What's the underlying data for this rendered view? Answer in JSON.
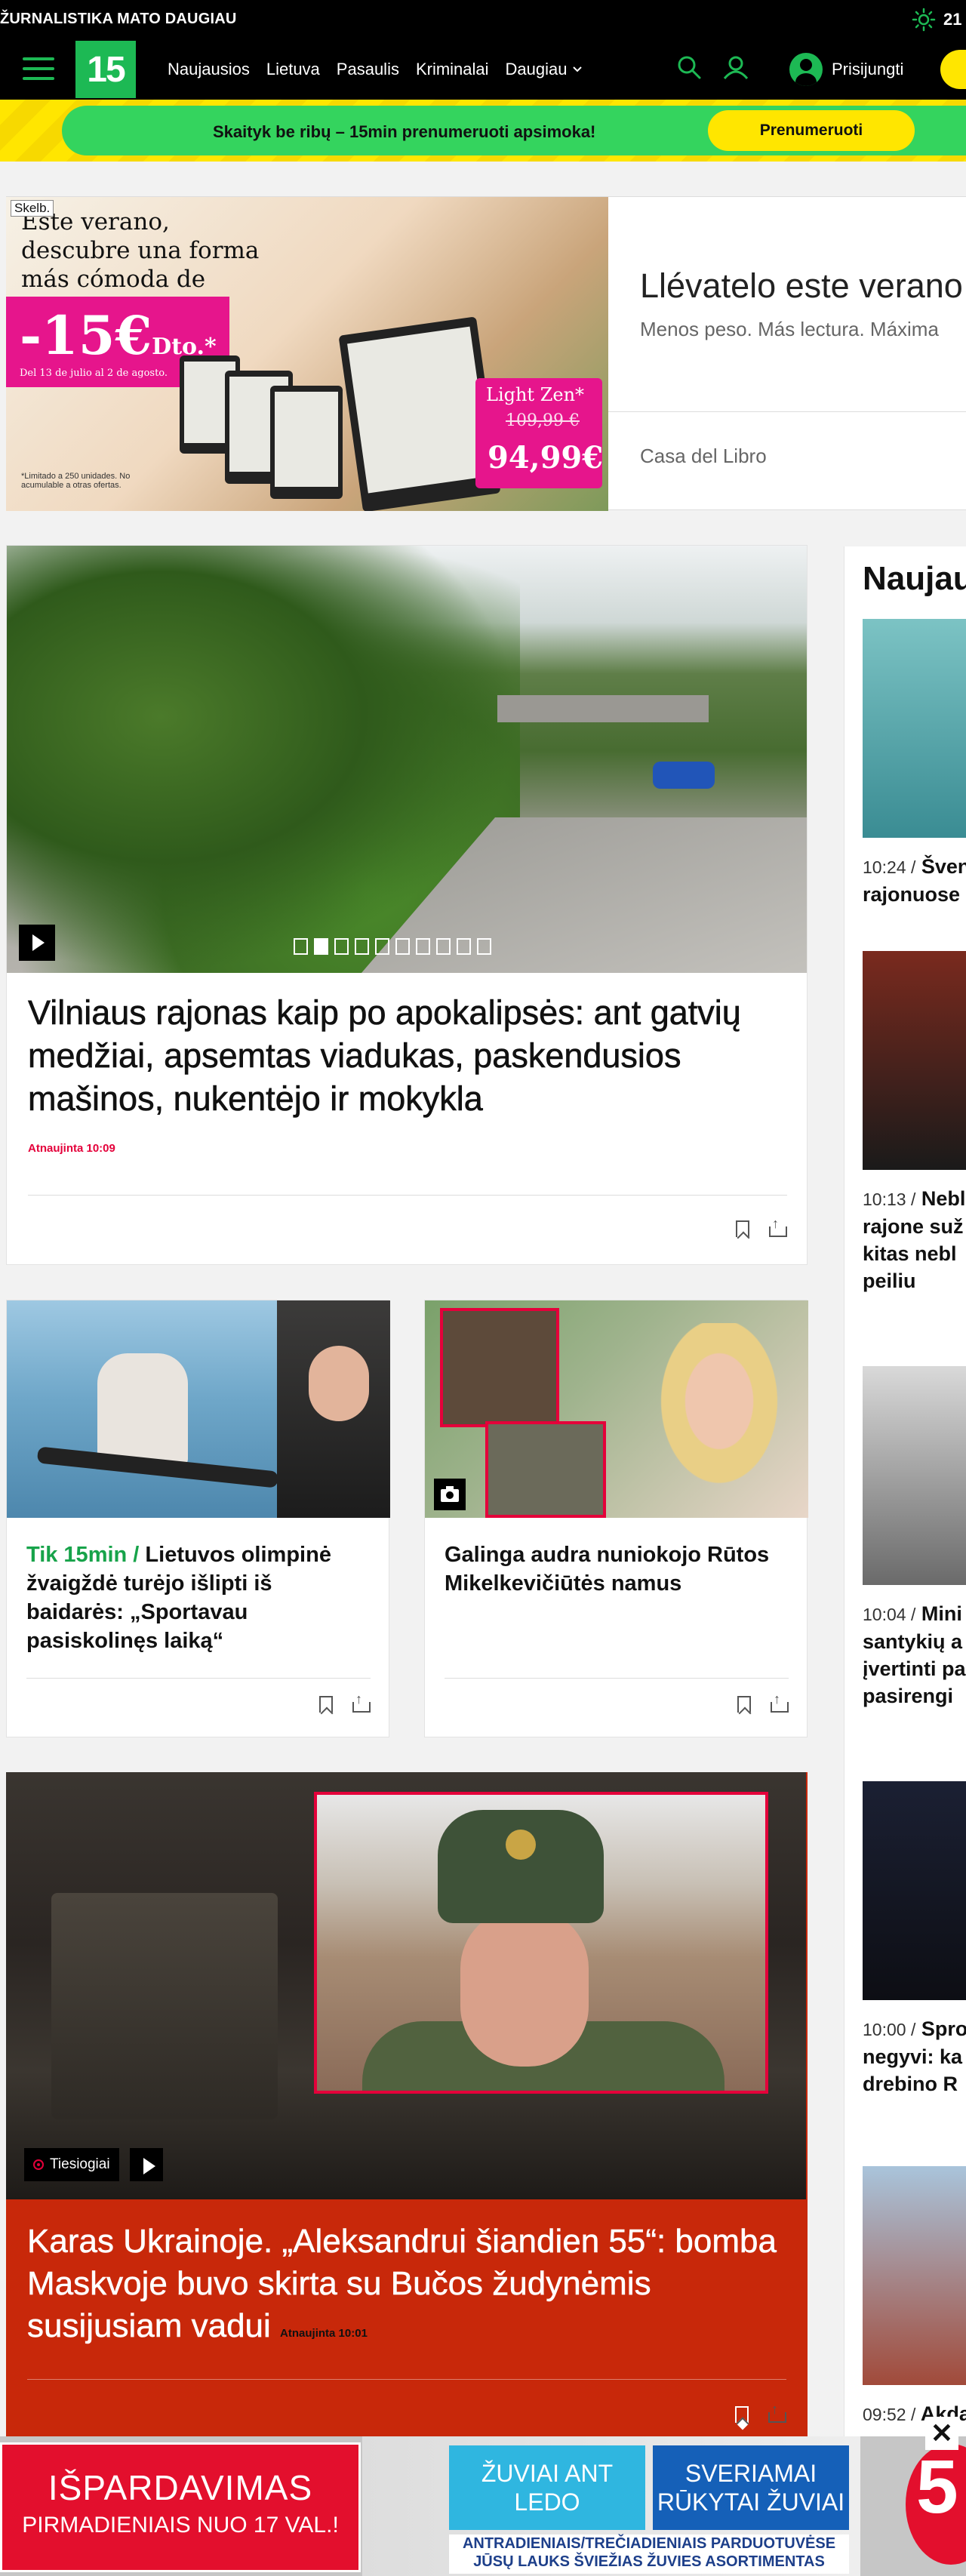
{
  "topbar": {
    "brand_line": "ŽURNALISTIKA MATO DAUGIAU",
    "temperature": "21"
  },
  "nav": {
    "logo": "15",
    "menu": [
      "Naujausios",
      "Lietuva",
      "Pasaulis",
      "Kriminalai",
      "Daugiau"
    ],
    "login": "Prisijungti",
    "icons": [
      "search-icon",
      "user-group-icon",
      "user-icon",
      "menu-icon",
      "chevron-down-icon",
      "sun-icon"
    ]
  },
  "promo": {
    "text": "Skaityk be ribų – 15min prenumeruoti apsimoka!",
    "button": "Prenumeruoti"
  },
  "ad": {
    "label": "Skelb.",
    "slogan": "Este verano, descubre una forma más cómoda de leer.",
    "discount": "-15€",
    "discount_suffix": "Dto.*",
    "dates": "Del 13 de julio al 2 de agosto.",
    "product": "Light Zen*",
    "old_price": "109,99 €",
    "new_price": "94,99€",
    "fine_print": "*Limitado a 250 unidades. No acumulable a otras ofertas.",
    "title": "Llévatelo este verano",
    "subtitle": "Menos peso. Más lectura. Máxima",
    "brand": "Casa del Libro"
  },
  "hero": {
    "title": "Vilniaus rajonas kaip po apokalipsės: ant gatvių medžiai, apsemtas viadukas, paskendusios mašinos, nukentėjo ir mokykla",
    "updated": "Atnaujinta 10:09",
    "slide_count": 10,
    "active_slide": 2
  },
  "cards": [
    {
      "kicker": "Tik 15min / ",
      "title": "Lietuvos olimpinė žvaigždė turėjo išlipti iš baidarės: „Sportavau pasiskolinęs laiką“"
    },
    {
      "kicker": "",
      "title": "Galinga audra nuniokojo Rūtos Mikelkevičiūtės namus"
    }
  ],
  "live": {
    "badge": "Tiesiogiai",
    "title": "Karas Ukrainoje. „Aleksandrui šiandien 55“: bomba Maskvoje buvo skirta su Bučos žudynėmis susijusiam vadui",
    "updated": "Atnaujinta 10:01"
  },
  "sidebar": {
    "heading": "Naujausi",
    "items": [
      {
        "time": "10:24 /",
        "lines": [
          "Šven",
          "rajonuose"
        ]
      },
      {
        "time": "10:13 /",
        "lines": [
          "Nebl",
          "rajone suž",
          "kitas nebl",
          "peiliu"
        ]
      },
      {
        "time": "10:04 /",
        "lines": [
          "Mini",
          "santykių a",
          "įvertinti pa",
          "pasirengi"
        ]
      },
      {
        "time": "10:00 /",
        "lines": [
          "Spro",
          "negyvi: ka",
          "drebino R"
        ]
      },
      {
        "time": "09:52 /",
        "lines": [
          "Akda"
        ]
      }
    ]
  },
  "bottom_ad": {
    "red_line1": "IŠPARDAVIMAS",
    "red_line2": "PIRMADIENIAIS NUO 17 VAL.!",
    "blue1": "ŽUVIAI ANT LEDO",
    "blue2": "SVERIAMAI RŪKYTAI ŽUVIAI",
    "strip": "ANTRADIENIAIS/TREČIADIENIAIS PARDUOTUVĖSE JŪSŲ LAUKS ŠVIEŽIAS ŽUVIES ASORTIMENTAS",
    "logo": "5",
    "close": "✕"
  }
}
